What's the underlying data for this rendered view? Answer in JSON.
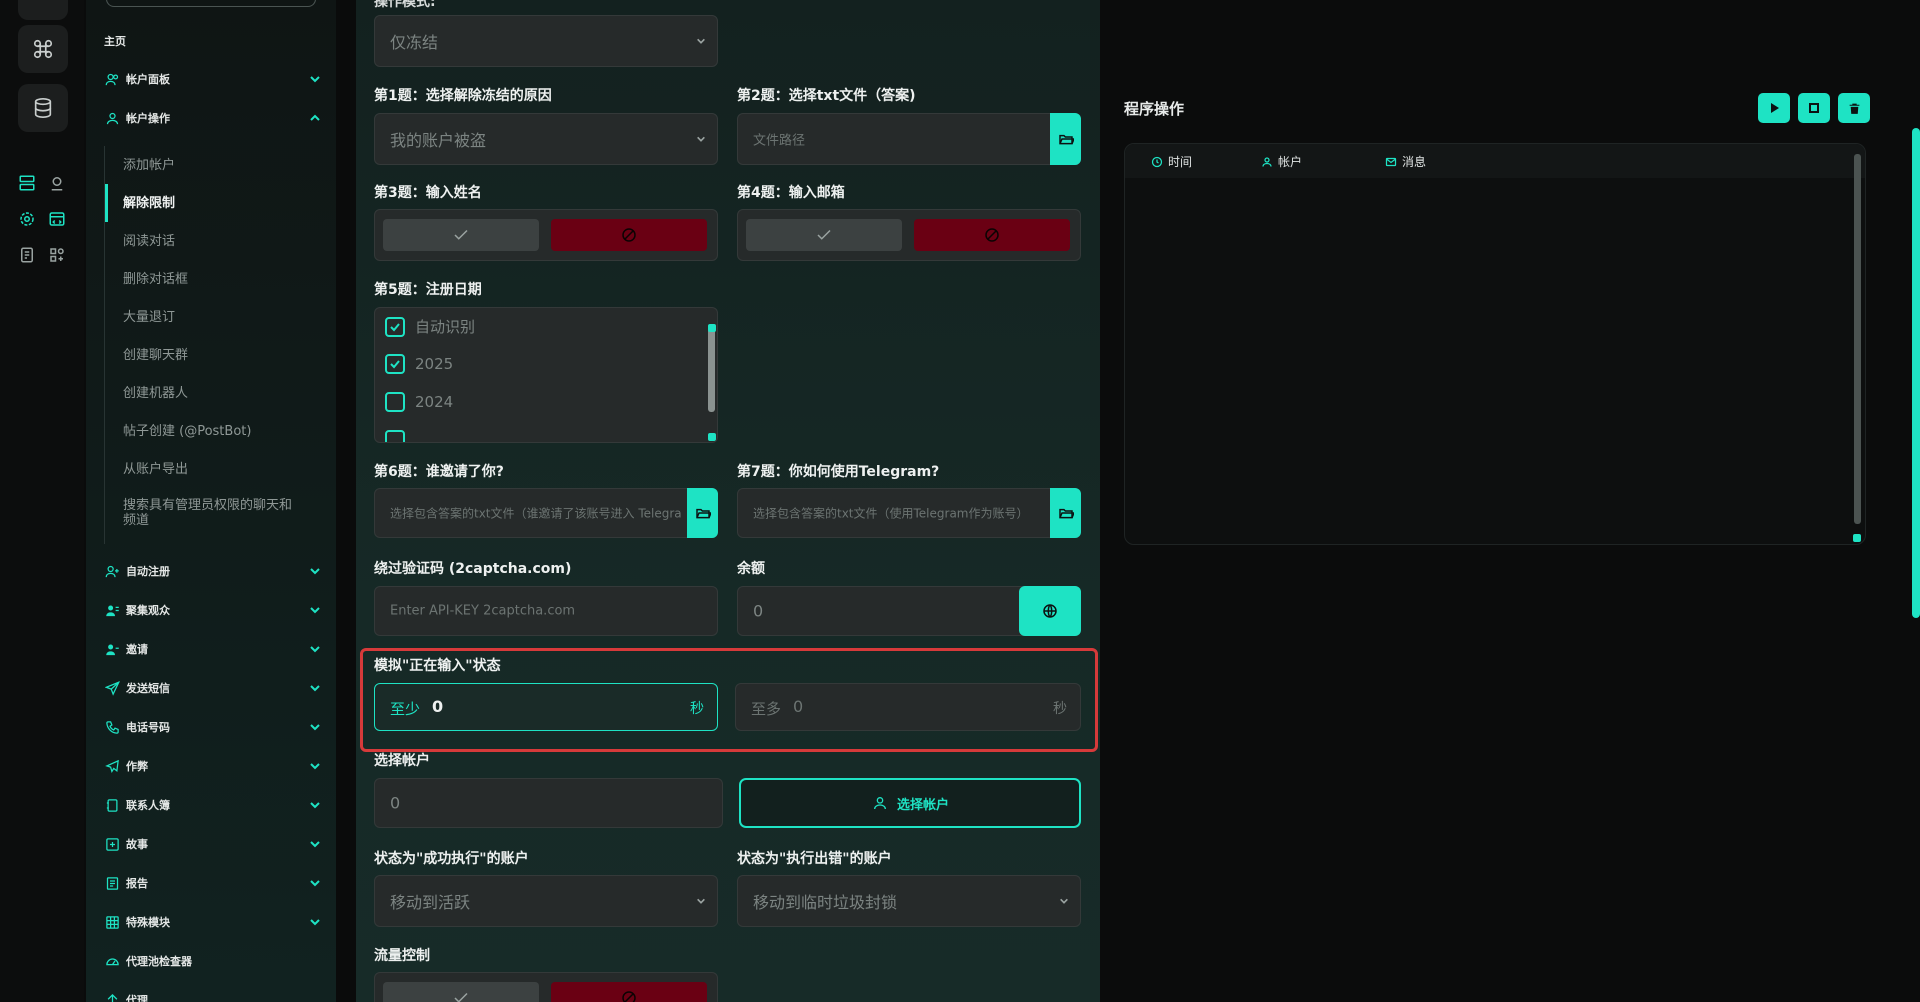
{
  "sidebar": {
    "home": "主页",
    "groups": [
      {
        "label": "帐户面板",
        "icon": "users-icon",
        "expanded": false
      },
      {
        "label": "帐户操作",
        "icon": "user-icon",
        "expanded": true
      }
    ],
    "sub_items": [
      "添加帐户",
      "解除限制",
      "阅读对话",
      "删除对话框",
      "大量退订",
      "创建聊天群",
      "创建机器人",
      "帖子创建 (@PostBot)",
      "从账户导出",
      "搜索具有管理员权限的聊天和频道"
    ],
    "active_sub": "解除限制",
    "groups_below": [
      {
        "label": "自动注册",
        "icon": "user-plus-icon"
      },
      {
        "label": "聚集观众",
        "icon": "users-gather-icon"
      },
      {
        "label": "邀请",
        "icon": "user-invite-icon"
      },
      {
        "label": "发送短信",
        "icon": "send-icon"
      },
      {
        "label": "电话号码",
        "icon": "phone-icon"
      },
      {
        "label": "作弊",
        "icon": "telegram-icon"
      },
      {
        "label": "联系人簿",
        "icon": "contacts-book-icon"
      },
      {
        "label": "故事",
        "icon": "story-plus-icon"
      },
      {
        "label": "报告",
        "icon": "report-icon"
      },
      {
        "label": "特殊模块",
        "icon": "module-grid-icon"
      },
      {
        "label": "代理池检查器",
        "icon": "gauge-icon"
      },
      {
        "label": "代理",
        "icon": "proxy-icon"
      }
    ]
  },
  "form": {
    "top_select_value": "仅冻结",
    "q1": {
      "label": "第1题：选择解除冻结的原因",
      "value": "我的账户被盗"
    },
    "q2": {
      "label": "第2题：选择txt文件（答案)",
      "placeholder": "文件路径"
    },
    "q3": {
      "label": "第3题：输入姓名"
    },
    "q4": {
      "label": "第4题：输入邮箱"
    },
    "q5": {
      "label": "第5题：注册日期",
      "options": [
        {
          "label": "自动识别",
          "checked": true
        },
        {
          "label": "2025",
          "checked": true
        },
        {
          "label": "2024",
          "checked": false
        }
      ]
    },
    "q6": {
      "label": "第6题：谁邀请了你?",
      "placeholder": "选择包含答案的txt文件（谁邀请了该账号进入 Telegram）"
    },
    "q7": {
      "label": "第7题：你如何使用Telegram?",
      "placeholder": "选择包含答案的txt文件（使用Telegram作为账号）"
    },
    "captcha": {
      "label": "绕过验证码 (2captcha.com)",
      "placeholder": "Enter API-KEY 2captcha.com"
    },
    "balance": {
      "label": "余额",
      "value": "0"
    },
    "typing": {
      "label": "模拟\"正在输入\"状态",
      "min_prefix": "至少",
      "min_value": "0",
      "max_prefix": "至多",
      "max_value": "0",
      "unit": "秒"
    },
    "accounts": {
      "label": "选择帐户",
      "value": "0",
      "button": "选择帐户"
    },
    "success": {
      "label": "状态为\"成功执行\"的账户",
      "value": "移动到活跃"
    },
    "error": {
      "label": "状态为\"执行出错\"的账户",
      "value": "移动到临时垃圾封锁"
    },
    "traffic": {
      "label": "流量控制"
    }
  },
  "right_panel": {
    "title": "程序操作",
    "columns": [
      "时间",
      "帐户",
      "消息"
    ]
  },
  "colors": {
    "accent": "#1ee3c4",
    "danger": "#6a0013",
    "highlight": "#d63a3a"
  }
}
